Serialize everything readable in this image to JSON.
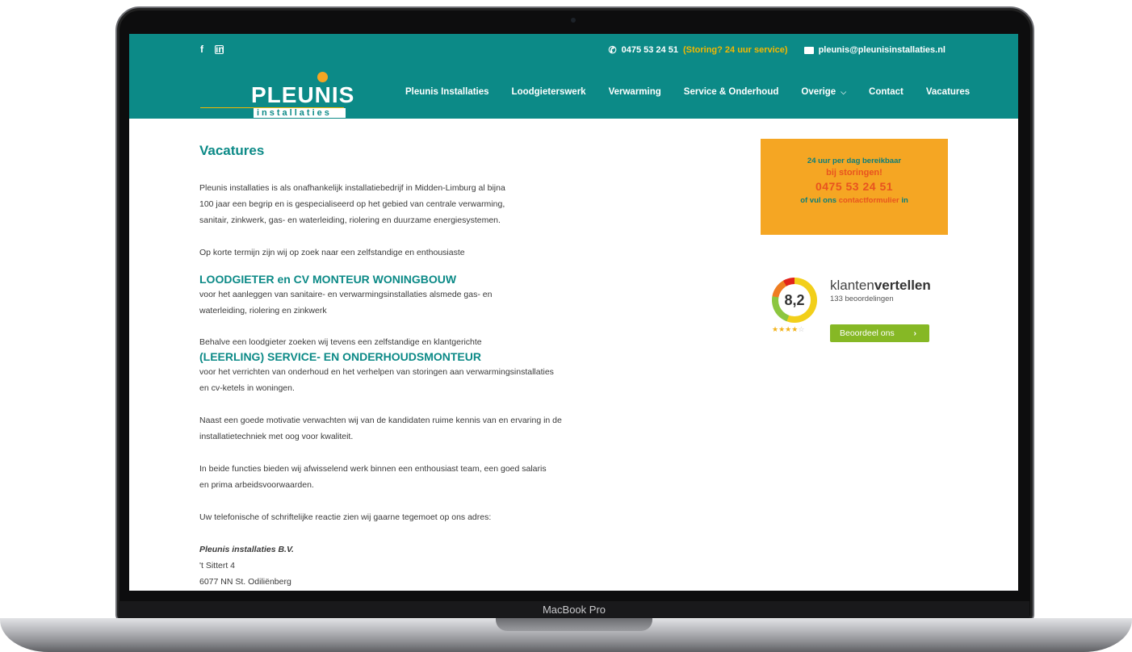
{
  "device": {
    "label": "MacBook Pro"
  },
  "topbar": {
    "facebook_icon": "f",
    "linkedin_icon": "in",
    "phone": "0475 53 24 51",
    "storing": "(Storing? 24 uur service)",
    "email": "pleunis@pleunisinstallaties.nl"
  },
  "logo": {
    "name": "PLEUNIS",
    "sub": "installaties"
  },
  "nav": {
    "items": [
      "Pleunis Installaties",
      "Loodgieterswerk",
      "Verwarming",
      "Service & Onderhoud",
      "Overige",
      "Contact",
      "Vacatures"
    ]
  },
  "main": {
    "title": "Vacatures",
    "intro": "Pleunis installaties is als onafhankelijk installatiebedrijf in Midden-Limburg al bijna\n100 jaar een begrip en is gespecialiseerd op het gebied van centrale verwarming,\nsanitair, zinkwerk, gas- en waterleiding, riolering en duurzame energiesystemen.",
    "search_line": "Op korte termijn zijn wij op zoek naar een zelfstandige en enthousiaste",
    "job1_title": "LOODGIETER en CV MONTEUR WONINGBOUW",
    "job1_desc": "voor het aanleggen van sanitaire- en verwarmingsinstallaties alsmede gas- en\nwaterleiding, riolering en zinkwerk",
    "job2_intro": "Behalve een loodgieter zoeken wij tevens een zelfstandige en klantgerichte",
    "job2_title": "(LEERLING) SERVICE- EN ONDERHOUDSMONTEUR",
    "job2_desc": "voor het verrichten van onderhoud en het verhelpen van storingen aan verwarmingsinstallaties\nen cv-ketels in woningen.",
    "requirements": "Naast een goede motivatie verwachten wij van de kandidaten ruime kennis van en ervaring in de\ninstallatietechniek met oog voor kwaliteit.",
    "offer": "In beide functies bieden wij afwisselend werk binnen een enthousiast team, een goed salaris\nen prima arbeidsvoorwaarden.",
    "reaction": "Uw telefonische of schriftelijke reactie zien wij gaarne tegemoet op ons adres:",
    "address": {
      "company": "Pleunis installaties B.V.",
      "street": "'t Sittert 4",
      "city": "6077 NN St. Odiliënberg"
    }
  },
  "emergency": {
    "line1": "24 uur per dag bereikbaar",
    "line2": "bij storingen!",
    "phone": "0475 53 24 51",
    "line4_pre": "of vul ons",
    "line4_link": "contactformulier",
    "line4_post": "in"
  },
  "reviews": {
    "score": "8,2",
    "brand_light": "klanten",
    "brand_bold": "vertellen",
    "count": "133 beoordelingen",
    "stars": 4,
    "button": "Beoordeel ons",
    "button_arrow": "›"
  },
  "colors": {
    "teal": "#0c8a87",
    "orange": "#f5a623",
    "red_orange": "#e8531f",
    "green": "#86b825"
  }
}
